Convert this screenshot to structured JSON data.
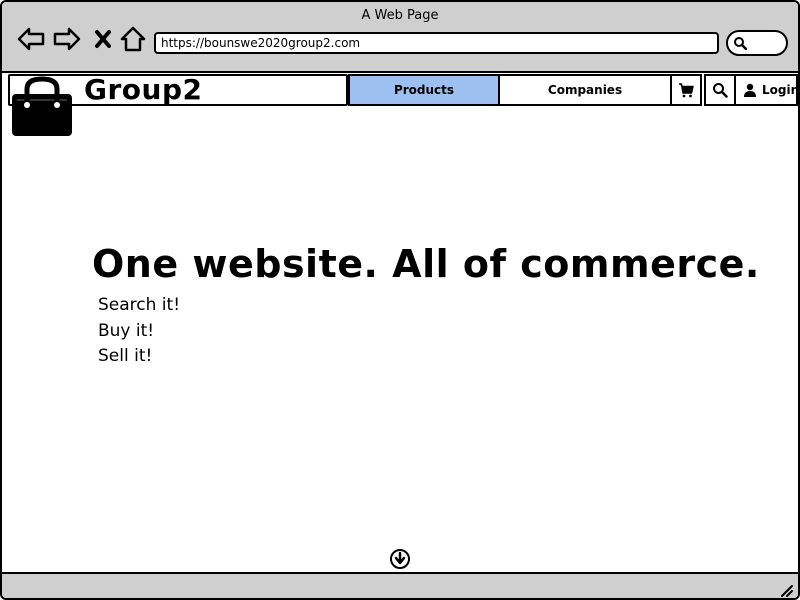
{
  "window": {
    "title": "A Web Page"
  },
  "browser": {
    "url": "https://bounswe2020group2.com",
    "icons": [
      "back-icon",
      "forward-icon",
      "stop-icon",
      "home-icon",
      "search-icon"
    ]
  },
  "site": {
    "brand": "Group2",
    "nav": {
      "products_label": "Products",
      "companies_label": "Companies",
      "login_label": "Login",
      "active_tab": "Products",
      "accent_color": "#9ec0f0"
    }
  },
  "hero": {
    "title": "One website. All of commerce.",
    "lines": [
      "Search it!",
      "Buy it!",
      "Sell it!"
    ]
  }
}
